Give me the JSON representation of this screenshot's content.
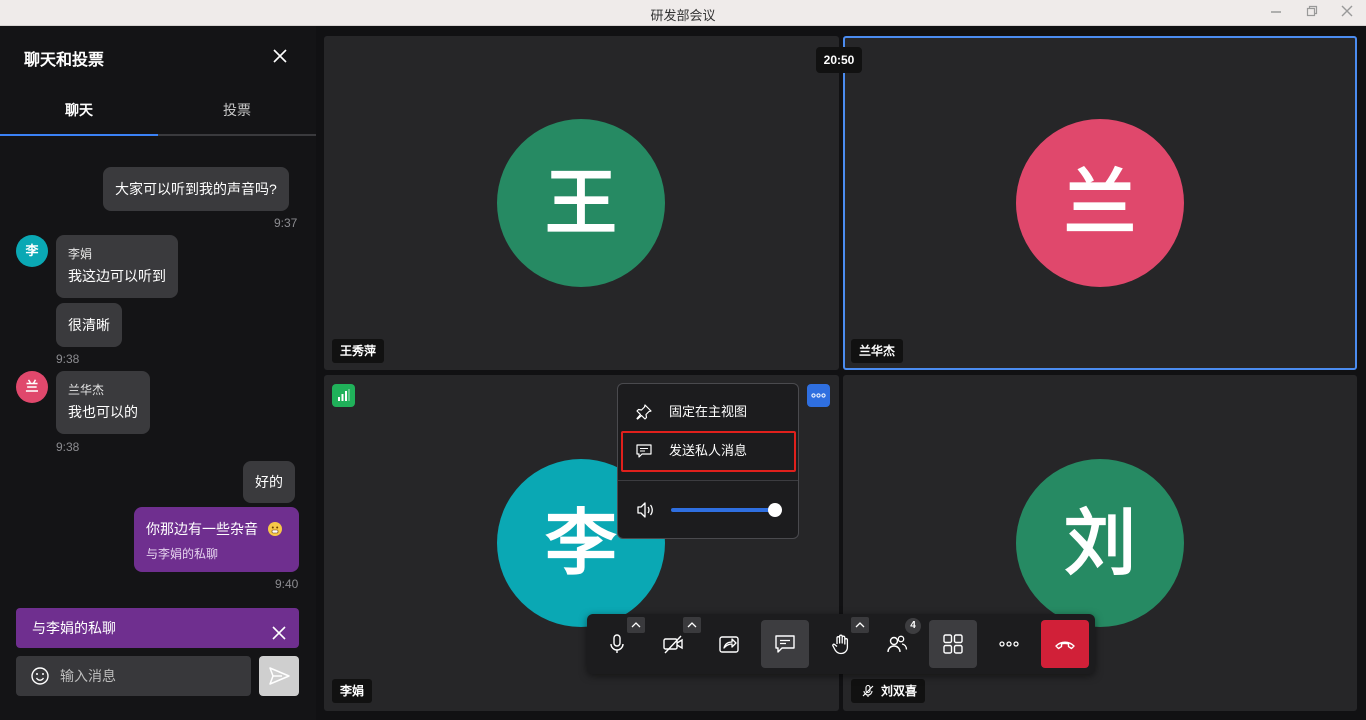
{
  "window": {
    "title": "研发部会议"
  },
  "sidebar": {
    "title": "聊天和投票",
    "tabs": [
      {
        "label": "聊天"
      },
      {
        "label": "投票"
      }
    ],
    "messages": {
      "m1": {
        "text": "大家可以听到我的声音吗?",
        "time": "9:37"
      },
      "m2": {
        "avatar": "李",
        "sender": "李娟",
        "text1": "我这边可以听到",
        "text2": "很清晰",
        "time": "9:38"
      },
      "m3": {
        "avatar": "兰",
        "sender": "兰华杰",
        "text": "我也可以的",
        "time": "9:38"
      },
      "m4": {
        "text": "好的"
      },
      "m5": {
        "text": "你那边有一些杂音",
        "note": "与李娟的私聊",
        "time": "9:40"
      }
    },
    "private_bar": {
      "label": "与李娟的私聊"
    },
    "input": {
      "placeholder": "输入消息"
    }
  },
  "tiles": {
    "t1": {
      "initial": "王",
      "name": "王秀萍"
    },
    "t2": {
      "initial": "兰",
      "name": "兰华杰"
    },
    "t3": {
      "initial": "李",
      "name": "李娟"
    },
    "t4": {
      "initial": "刘",
      "name": "刘双喜"
    }
  },
  "timer": "20:50",
  "context_menu": {
    "pin": "固定在主视图",
    "private_message": "发送私人消息",
    "volume": 1.0
  },
  "toolbar": {
    "participants_count": "4"
  },
  "colors": {
    "avatar_green": "#268a63",
    "avatar_pink": "#e0486c",
    "avatar_teal": "#0aa8b4",
    "private": "#6f2f8f",
    "accent": "#3b82f6",
    "end_call": "#d12038"
  },
  "icons": [
    "pin-icon",
    "chat-icon",
    "speaker-icon",
    "mic-icon",
    "camera-off-icon",
    "share-icon",
    "raise-hand-icon",
    "participants-icon",
    "grid-icon",
    "more-icon",
    "end-call-icon",
    "emoji-icon",
    "send-icon",
    "close-icon",
    "signal-icon",
    "muted-mic-icon"
  ]
}
